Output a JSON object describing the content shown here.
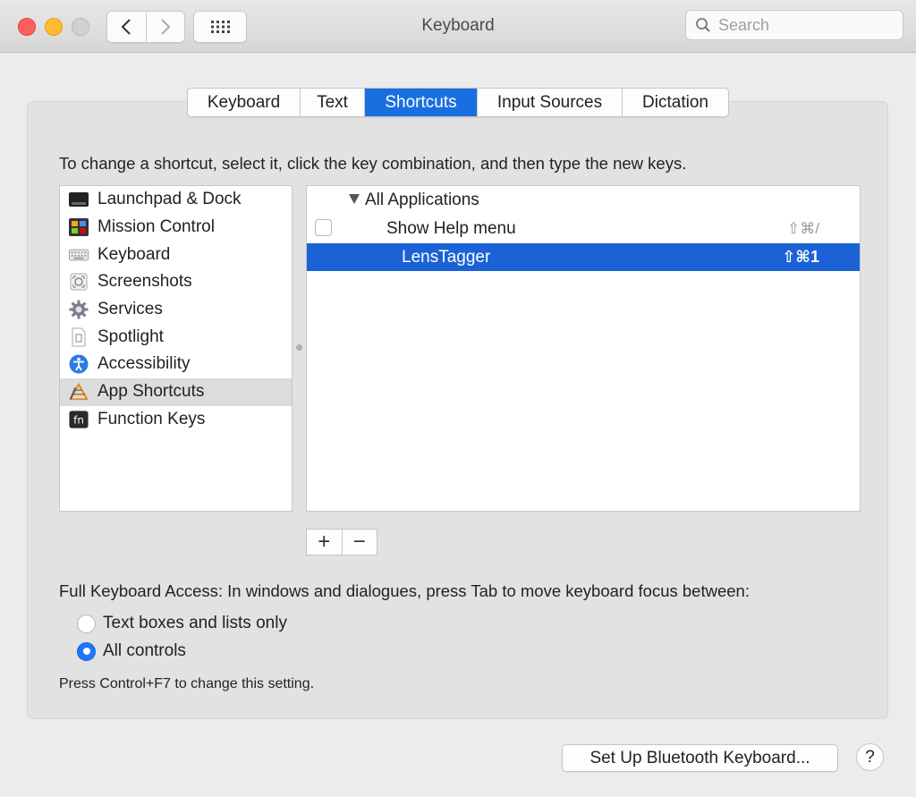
{
  "window": {
    "title": "Keyboard"
  },
  "search": {
    "placeholder": "Search"
  },
  "tabs": [
    {
      "label": "Keyboard",
      "active": false
    },
    {
      "label": "Text",
      "active": false
    },
    {
      "label": "Shortcuts",
      "active": true
    },
    {
      "label": "Input Sources",
      "active": false
    },
    {
      "label": "Dictation",
      "active": false
    }
  ],
  "instruction": "To change a shortcut, select it, click the key combination, and then type the new keys.",
  "categories": [
    {
      "label": "Launchpad & Dock",
      "icon": "launchpad-dock-icon"
    },
    {
      "label": "Mission Control",
      "icon": "mission-control-icon"
    },
    {
      "label": "Keyboard",
      "icon": "keyboard-icon"
    },
    {
      "label": "Screenshots",
      "icon": "screenshot-icon"
    },
    {
      "label": "Services",
      "icon": "gear-icon"
    },
    {
      "label": "Spotlight",
      "icon": "document-icon"
    },
    {
      "label": "Accessibility",
      "icon": "accessibility-icon"
    },
    {
      "label": "App Shortcuts",
      "icon": "app-shortcuts-icon",
      "selected": true
    },
    {
      "label": "Function Keys",
      "icon": "fn-key-icon"
    }
  ],
  "shortcuts": {
    "group_label": "All Applications",
    "item_label": "Show Help menu",
    "item_keys": "⇧⌘/",
    "selected_label": "LensTagger",
    "selected_keys": "⇧⌘1"
  },
  "controls": {
    "add_label": "+",
    "remove_label": "−"
  },
  "full_keyboard_access": {
    "label": "Full Keyboard Access: In windows and dialogues, press Tab to move keyboard focus between:",
    "options": [
      {
        "label": "Text boxes and lists only",
        "selected": false
      },
      {
        "label": "All controls",
        "selected": true
      }
    ],
    "note": "Press Control+F7 to change this setting."
  },
  "footer": {
    "bluetooth_button": "Set Up Bluetooth Keyboard...",
    "help_button": "?"
  },
  "colors": {
    "accent": "#1a6fe0",
    "selection": "#1a62d6"
  }
}
